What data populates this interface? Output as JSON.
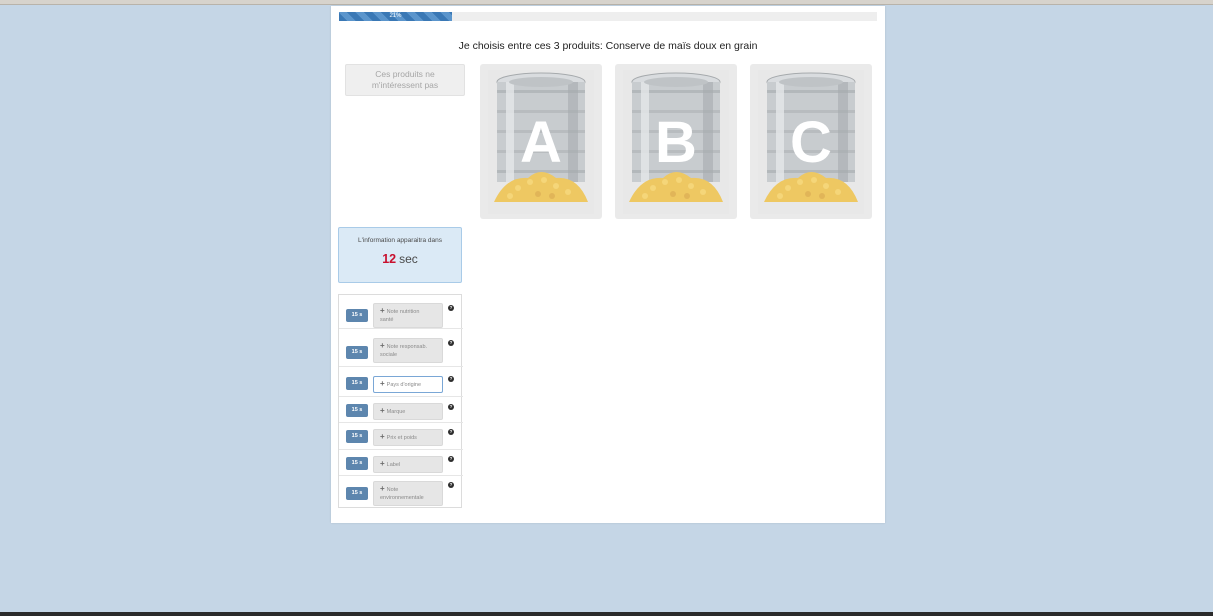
{
  "progress": {
    "percent": 21,
    "label": "21%"
  },
  "title": "Je choisis entre ces 3 produits: Conserve de maïs doux en grain",
  "not_interested": {
    "line1": "Ces produits ne",
    "line2": "m'intéressent pas"
  },
  "products": [
    {
      "letter": "A"
    },
    {
      "letter": "B"
    },
    {
      "letter": "C"
    }
  ],
  "info": {
    "text": "L'information apparaitra dans",
    "seconds": "12",
    "unit": "sec"
  },
  "criteria": [
    {
      "time": "15 s",
      "line1": "Note nutrition",
      "line2": "santé"
    },
    {
      "time": "15 s",
      "line1": "Note responsab.",
      "line2": "sociale"
    },
    {
      "time": "15 s",
      "line1": "Pays d'origine",
      "line2": ""
    },
    {
      "time": "15 s",
      "line1": "Marque",
      "line2": ""
    },
    {
      "time": "15 s",
      "line1": "Prix et poids",
      "line2": ""
    },
    {
      "time": "15 s",
      "line1": "Label",
      "line2": ""
    },
    {
      "time": "15 s",
      "line1": "Note",
      "line2": "environnementale"
    }
  ],
  "icons": {
    "plus": "plus-icon",
    "help": "question-circle-icon"
  },
  "colors": {
    "accent": "#5d86ae",
    "timer": "#c8102e",
    "info_bg": "#dbeaf6"
  }
}
